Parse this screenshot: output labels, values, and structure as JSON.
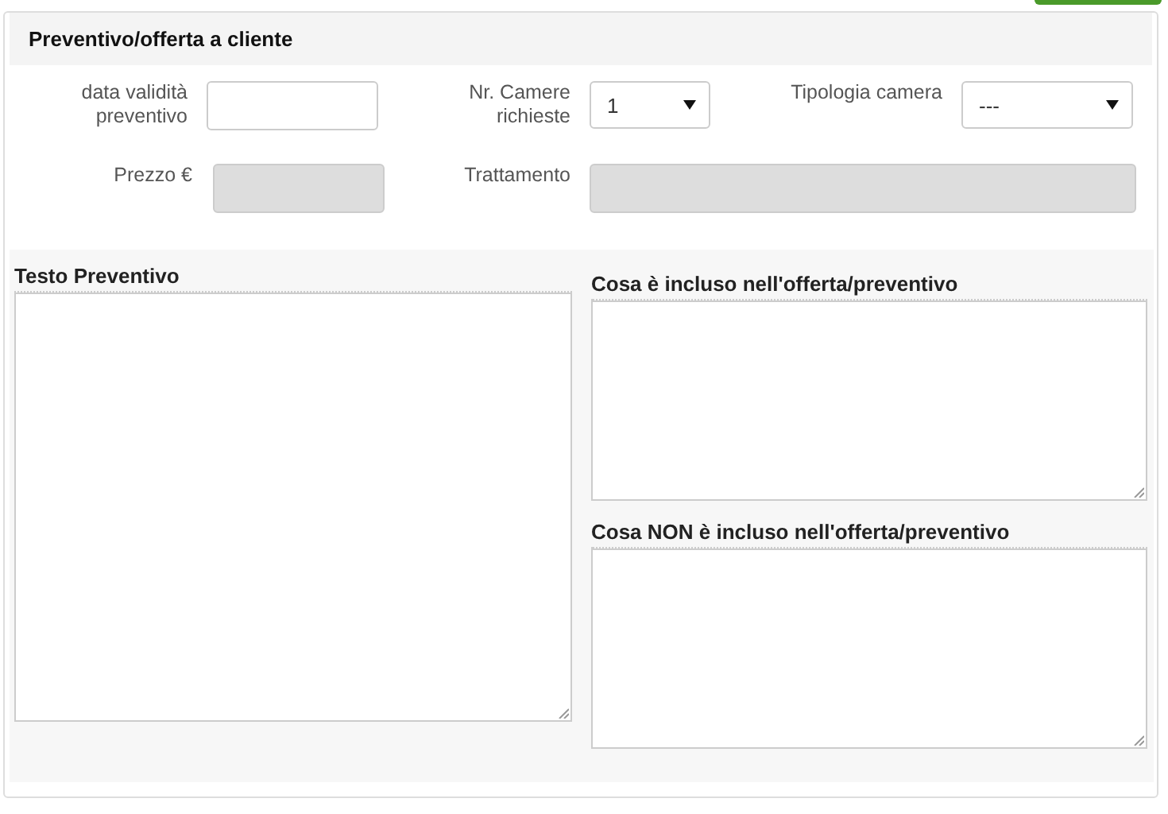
{
  "panel": {
    "title": "Preventivo/offerta a cliente"
  },
  "form_rows": [
    {
      "fields": [
        {
          "label": "data validità preventivo",
          "kind": "text",
          "disabled": false
        },
        {
          "label": "Nr. Camere richieste",
          "kind": "select",
          "value": "1",
          "disabled": false
        },
        {
          "label": "Tipologia camera",
          "kind": "select",
          "value": "---",
          "disabled": false
        }
      ]
    },
    {
      "fields": [
        {
          "label": "Prezzo €",
          "kind": "text",
          "disabled": true
        },
        {
          "label": "Trattamento",
          "kind": "wide",
          "disabled": true
        }
      ]
    }
  ],
  "text_areas": {
    "left": {
      "label": "Testo Preventivo"
    },
    "right": [
      {
        "label": "Cosa è incluso nell'offerta/preventivo"
      },
      {
        "label": "Cosa NON è incluso nell'offerta/preventivo"
      }
    ]
  }
}
